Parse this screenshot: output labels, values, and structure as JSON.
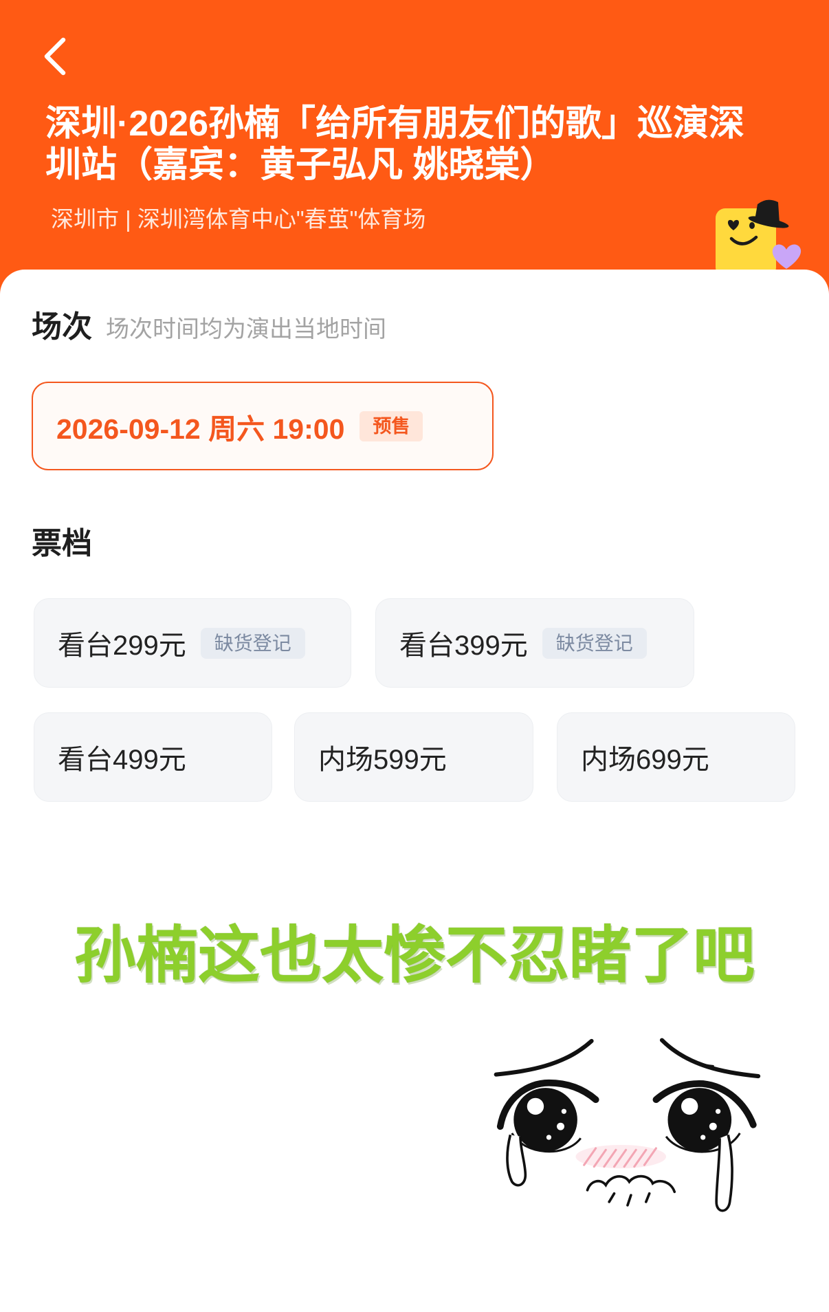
{
  "header": {
    "back_icon": "chevron-left-icon",
    "title": "深圳·2026孙楠「给所有朋友们的歌」巡演深圳站（嘉宾：黄子弘凡 姚晓棠）",
    "venue": "深圳市 | 深圳湾体育中心\"春茧\"体育场",
    "mascot_icon": "yellow-mascot-icon"
  },
  "sessions": {
    "heading": "场次",
    "note": "场次时间均为演出当地时间",
    "items": [
      {
        "datetime": "2026-09-12 周六 19:00",
        "badge": "预售",
        "selected": true
      }
    ]
  },
  "tickets": {
    "heading": "票档",
    "items": [
      {
        "label": "看台299元",
        "badge": "缺货登记"
      },
      {
        "label": "看台399元",
        "badge": "缺货登记"
      },
      {
        "label": "看台499元"
      },
      {
        "label": "内场599元"
      },
      {
        "label": "内场699元"
      }
    ]
  },
  "overlay": {
    "caption": "孙楠这也太惨不忍睹了吧",
    "face_icon": "crying-face-icon"
  },
  "colors": {
    "brand_orange": "#FF5A14",
    "accent_orange": "#F4571E",
    "presale_badge_bg": "#FFE6DA",
    "tile_bg": "#F5F6F8",
    "soldout_badge_bg": "#E8ECF2",
    "soldout_badge_text": "#7C8AA1",
    "caption_green": "#8DCF2C"
  }
}
